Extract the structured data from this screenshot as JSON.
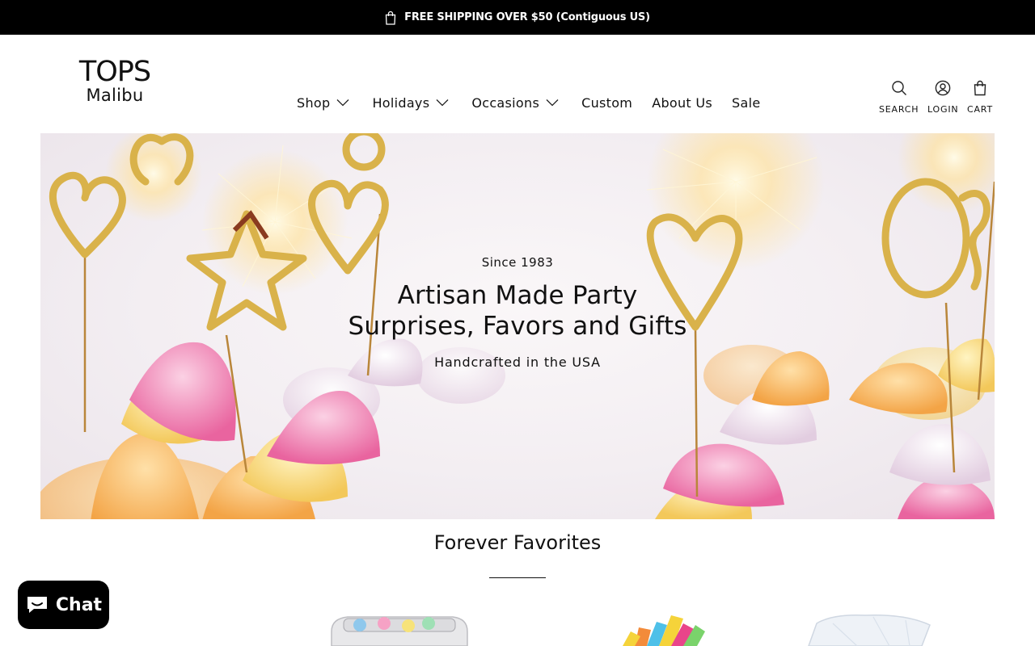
{
  "announcement": {
    "text": "FREE SHIPPING OVER $50 (Contiguous US)"
  },
  "brand": {
    "name_top": "TOPS",
    "name_bottom": "Malibu"
  },
  "nav": {
    "shop": "Shop",
    "holidays": "Holidays",
    "occasions": "Occasions",
    "custom": "Custom",
    "about": "About Us",
    "sale": "Sale"
  },
  "utility": {
    "search": "SEARCH",
    "login": "LOGIN",
    "cart": "CART"
  },
  "hero": {
    "eyebrow": "Since 1983",
    "headline_line1": "Artisan Made Party",
    "headline_line2": "Surprises, Favors and Gifts",
    "subtext": "Handcrafted in the USA"
  },
  "section": {
    "title": "Forever Favorites"
  },
  "chat": {
    "label": "Chat"
  },
  "colors": {
    "topbar": "#000000",
    "text": "#111111",
    "gold": "#d9b24a",
    "pink": "#e96aa5",
    "yellow": "#f3d86a"
  }
}
